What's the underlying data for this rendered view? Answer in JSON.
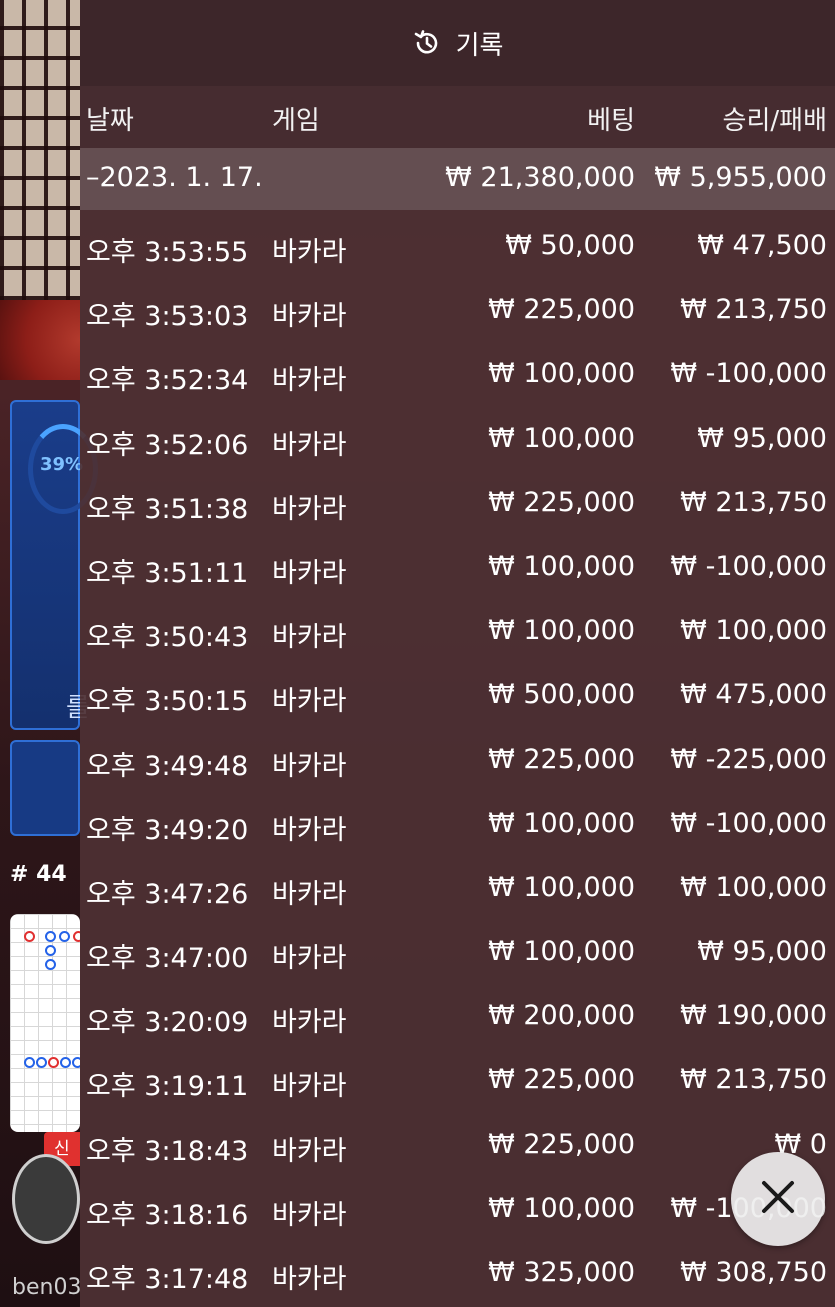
{
  "background": {
    "progress_percent": "39%",
    "side_glyph": "를",
    "round_label": "# 44",
    "new_badge": "신규",
    "username": "ben03"
  },
  "panel": {
    "title": "기록",
    "columns": {
      "date": "날짜",
      "game": "게임",
      "bet": "베팅",
      "win_loss": "승리/패배"
    },
    "summary": {
      "date": "–2023. 1. 17.",
      "bet": "₩ 21,380,000",
      "win_loss": "₩ 5,955,000"
    },
    "rows": [
      {
        "time": "오후 3:53:55",
        "game": "바카라",
        "bet": "₩ 50,000",
        "win_loss": "₩ 47,500"
      },
      {
        "time": "오후 3:53:03",
        "game": "바카라",
        "bet": "₩ 225,000",
        "win_loss": "₩ 213,750"
      },
      {
        "time": "오후 3:52:34",
        "game": "바카라",
        "bet": "₩ 100,000",
        "win_loss": "₩ -100,000"
      },
      {
        "time": "오후 3:52:06",
        "game": "바카라",
        "bet": "₩ 100,000",
        "win_loss": "₩ 95,000"
      },
      {
        "time": "오후 3:51:38",
        "game": "바카라",
        "bet": "₩ 225,000",
        "win_loss": "₩ 213,750"
      },
      {
        "time": "오후 3:51:11",
        "game": "바카라",
        "bet": "₩ 100,000",
        "win_loss": "₩ -100,000"
      },
      {
        "time": "오후 3:50:43",
        "game": "바카라",
        "bet": "₩ 100,000",
        "win_loss": "₩ 100,000"
      },
      {
        "time": "오후 3:50:15",
        "game": "바카라",
        "bet": "₩ 500,000",
        "win_loss": "₩ 475,000"
      },
      {
        "time": "오후 3:49:48",
        "game": "바카라",
        "bet": "₩ 225,000",
        "win_loss": "₩ -225,000"
      },
      {
        "time": "오후 3:49:20",
        "game": "바카라",
        "bet": "₩ 100,000",
        "win_loss": "₩ -100,000"
      },
      {
        "time": "오후 3:47:26",
        "game": "바카라",
        "bet": "₩ 100,000",
        "win_loss": "₩ 100,000"
      },
      {
        "time": "오후 3:47:00",
        "game": "바카라",
        "bet": "₩ 100,000",
        "win_loss": "₩ 95,000"
      },
      {
        "time": "오후 3:20:09",
        "game": "바카라",
        "bet": "₩ 200,000",
        "win_loss": "₩ 190,000"
      },
      {
        "time": "오후 3:19:11",
        "game": "바카라",
        "bet": "₩ 225,000",
        "win_loss": "₩ 213,750"
      },
      {
        "time": "오후 3:18:43",
        "game": "바카라",
        "bet": "₩ 225,000",
        "win_loss": "₩ 0"
      },
      {
        "time": "오후 3:18:16",
        "game": "바카라",
        "bet": "₩ 100,000",
        "win_loss": "₩ -100,000"
      },
      {
        "time": "오후 3:17:48",
        "game": "바카라",
        "bet": "₩ 325,000",
        "win_loss": "₩ 308,750"
      }
    ]
  },
  "icons": {
    "history": "history-icon",
    "close": "close-icon"
  }
}
